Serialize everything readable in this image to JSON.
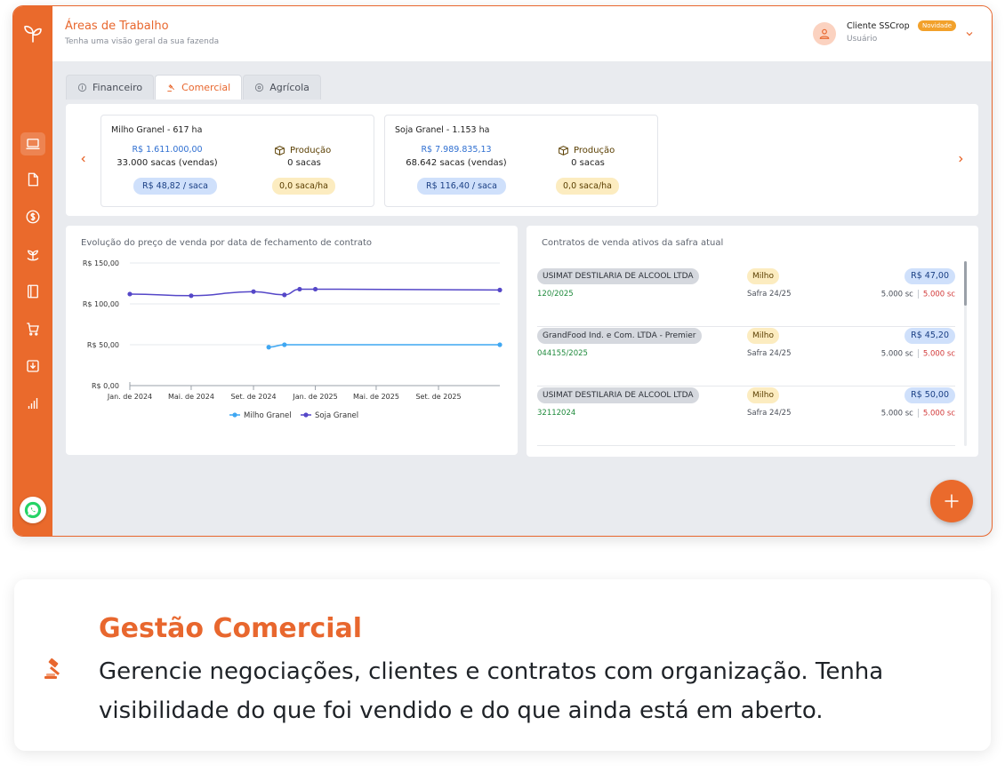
{
  "header": {
    "title": "Áreas de Trabalho",
    "subtitle": "Tenha uma visão geral da sua fazenda",
    "user_name": "Cliente SSCrop",
    "user_badge": "Novidade",
    "user_role": "Usuário"
  },
  "tabs": [
    {
      "label": "Financeiro",
      "icon": "coin-icon"
    },
    {
      "label": "Comercial",
      "icon": "gavel-icon"
    },
    {
      "label": "Agrícola",
      "icon": "seed-icon"
    }
  ],
  "active_tab": "Comercial",
  "sidebar": {
    "items": [
      "laptop-icon",
      "document-icon",
      "dollar-icon",
      "plant-icon",
      "book-icon",
      "cart-icon",
      "download-icon",
      "bar-chart-icon"
    ],
    "active": "laptop-icon"
  },
  "kpis": [
    {
      "title": "Milho Granel - 617 ha",
      "price": "R$ 1.611.000,00",
      "sales": "33.000 sacas (vendas)",
      "avg_price": "R$ 48,82 / saca",
      "production_label": "Produção",
      "production": "0 sacas",
      "yield": "0,0 saca/ha"
    },
    {
      "title": "Soja Granel - 1.153 ha",
      "price": "R$ 7.989.835,13",
      "sales": "68.642 sacas (vendas)",
      "avg_price": "R$ 116,40 / saca",
      "production_label": "Produção",
      "production": "0 sacas",
      "yield": "0,0 saca/ha"
    }
  ],
  "chart_data": {
    "type": "line",
    "title": "Evolução do preço de venda por data de fechamento de contrato",
    "xlabel": "",
    "ylabel": "",
    "ylim": [
      0,
      150
    ],
    "y_ticks": [
      "R$ 0,00",
      "R$ 50,00",
      "R$ 100,00",
      "R$ 150,00"
    ],
    "y_tick_values": [
      0,
      50,
      100,
      150
    ],
    "x_ticks": [
      "Jan. de 2024",
      "Mai. de 2024",
      "Set. de 2024",
      "Jan. de 2025",
      "Mai. de 2025",
      "Set. de 2025"
    ],
    "x_tick_values": [
      "2024-01-01",
      "2024-05-01",
      "2024-09-01",
      "2025-01-01",
      "2025-05-01",
      "2025-09-01"
    ],
    "xlim": [
      "2024-01-01",
      "2025-12-31"
    ],
    "grid": true,
    "legend": "bottom",
    "series": [
      {
        "name": "Milho Granel",
        "color": "#3fa7f2",
        "points": [
          [
            "2024-10-01",
            47
          ],
          [
            "2024-11-01",
            50
          ],
          [
            "2025-12-31",
            50
          ]
        ]
      },
      {
        "name": "Soja Granel",
        "color": "#5547c8",
        "points": [
          [
            "2024-01-01",
            112
          ],
          [
            "2024-05-01",
            110
          ],
          [
            "2024-09-01",
            115
          ],
          [
            "2024-11-01",
            111
          ],
          [
            "2024-12-01",
            118
          ],
          [
            "2025-01-01",
            118
          ],
          [
            "2025-12-31",
            117
          ]
        ]
      }
    ]
  },
  "contracts": {
    "title": "Contratos de venda ativos da safra atual",
    "rows": [
      {
        "client": "USIMAT DESTILARIA DE ALCOOL LTDA",
        "number": "120/2025",
        "crop": "Milho",
        "season": "Safra 24/25",
        "price": "R$ 47,00",
        "qty": "5.000 sc",
        "qty_open": "5.000 sc"
      },
      {
        "client": "GrandFood Ind. e Com. LTDA - Premier",
        "number": "044155/2025",
        "crop": "Milho",
        "season": "Safra 24/25",
        "price": "R$ 45,20",
        "qty": "5.000 sc",
        "qty_open": "5.000 sc"
      },
      {
        "client": "USIMAT DESTILARIA DE ALCOOL LTDA",
        "number": "32112024",
        "crop": "Milho",
        "season": "Safra 24/25",
        "price": "R$ 50,00",
        "qty": "5.000 sc",
        "qty_open": "5.000 sc"
      }
    ]
  },
  "feature": {
    "title": "Gestão Comercial",
    "description": "Gerencie negociações, clientes e contratos com organização. Tenha visibilidade do que foi vendido e do que ainda está em aberto."
  },
  "colors": {
    "brand": "#ea6a2c",
    "blue_chip": "#cfe0fb",
    "yellow_chip": "#fcecc0"
  }
}
